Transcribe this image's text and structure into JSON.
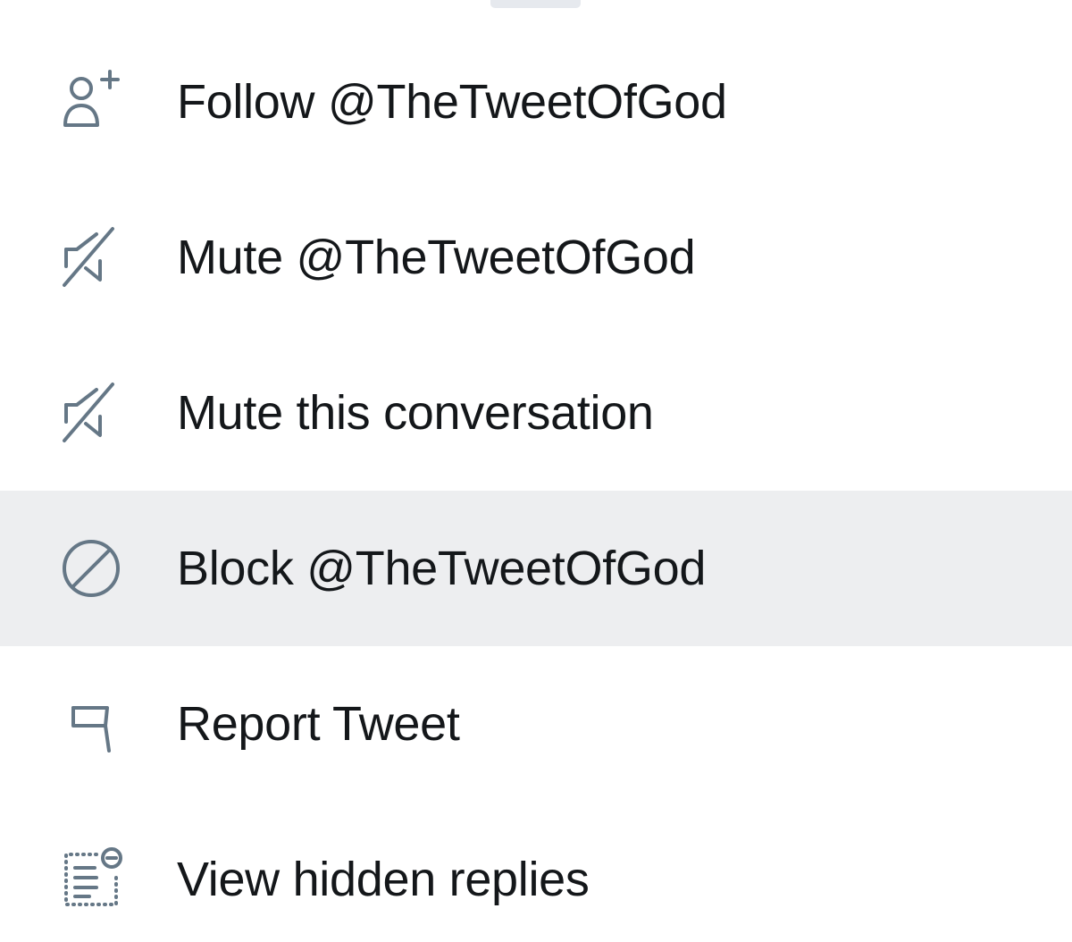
{
  "menu": {
    "items": [
      {
        "label": "Follow @TheTweetOfGod",
        "icon": "follow-user-icon"
      },
      {
        "label": "Mute @TheTweetOfGod",
        "icon": "speaker-muted-icon"
      },
      {
        "label": "Mute this conversation",
        "icon": "speaker-muted-icon"
      },
      {
        "label": "Block @TheTweetOfGod",
        "icon": "block-icon",
        "pressed": true
      },
      {
        "label": "Report Tweet",
        "icon": "flag-icon"
      },
      {
        "label": "View hidden replies",
        "icon": "hidden-replies-icon"
      }
    ]
  },
  "colors": {
    "icon": "#657786",
    "text": "#14171a",
    "pressed_background": "#edeef0",
    "grabber": "#e6e9ee",
    "background": "#ffffff"
  }
}
